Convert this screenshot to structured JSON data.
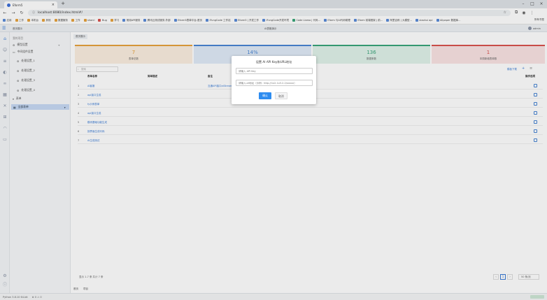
{
  "browser": {
    "tab_title": "Eform5",
    "new_tab": "+",
    "url": "localhost:8080/index.html#/",
    "bookmarks": [
      "应用",
      "工作",
      "本机台",
      "其他",
      "数据服务",
      "工作",
      "sharcl",
      "Bug",
      "学习",
      "常用API服务",
      "腾讯云测试服务-外部",
      "Eform5表单平台-首页",
      "iFungCode 工作站",
      "Eform5 | 开发工作",
      "iFungCode开发环境",
      "Code Llama | 代码...",
      "Eform 与AI代码助理",
      "Eform 前端框架 | 前...",
      "阿里百炼 | 大模型...",
      "xiaohui api",
      "Allpaper 数据库..."
    ],
    "all_bookmarks": "所有书签"
  },
  "sidebar": {
    "header": "我的项目",
    "items": [
      {
        "label": "模型设置"
      },
      {
        "label": "中间组件设置"
      },
      {
        "label": "处理设置_1"
      },
      {
        "label": "处理设置_2"
      },
      {
        "label": "处理设置_3"
      },
      {
        "label": "处理设置_4"
      },
      {
        "label": "表单"
      },
      {
        "label": "全部表单"
      }
    ]
  },
  "appbar": {
    "breadcrumb": "首页展示",
    "page_title": "AI表格演示",
    "user": "admin"
  },
  "main": {
    "tab": "首页展示",
    "cards": [
      {
        "value": "7",
        "label": "表单总数",
        "color": "#e6a23c",
        "bg": "#fbeee0"
      },
      {
        "value": "14%",
        "label": "",
        "color": "#4a86d4",
        "bg": "#e0ebf8"
      },
      {
        "value": "136",
        "label": "数据条数",
        "color": "#3aa57a",
        "bg": "#e0f2ea"
      },
      {
        "value": "1",
        "label": "本周新增表单数",
        "color": "#d9534f",
        "bg": "#fae3e3"
      }
    ],
    "search_placeholder": "搜索",
    "toolbar_right": "模板下载",
    "columns": [
      "表单名称",
      "简单描述",
      "备注",
      "操作选项"
    ],
    "rows": [
      {
        "n": "1",
        "name": "AI客服"
      },
      {
        "n": "2",
        "name": "api接口生成"
      },
      {
        "n": "3",
        "name": "fy示例表单"
      },
      {
        "n": "4",
        "name": "api接口生成"
      },
      {
        "n": "5",
        "name": "模块基础功能生成"
      },
      {
        "n": "6",
        "name": "按界面生成代码"
      },
      {
        "n": "7",
        "name": "AI生成测试"
      }
    ],
    "row1_note": "互通API接口aiStream&open",
    "pagination_text": "显示 1-7 条 共计 7 条",
    "page_current": "1",
    "page_size": "50 条/页",
    "bottom_tabs": [
      "首页",
      "项目"
    ]
  },
  "modal": {
    "title": "设置 AI API Key和URL地址",
    "apikey_placeholder": "请输入 API Key",
    "url_placeholder": "请输入url地址（示例：http://1x2.1x3.2.2/xxxxx）",
    "confirm_label": "确认",
    "cancel_label": "取消",
    "primary_color": "#2d8cf0"
  },
  "statusbar": {
    "left": "Python 3.8.10 64-bit",
    "mid": "⊗ 0  ⚠ 0"
  }
}
